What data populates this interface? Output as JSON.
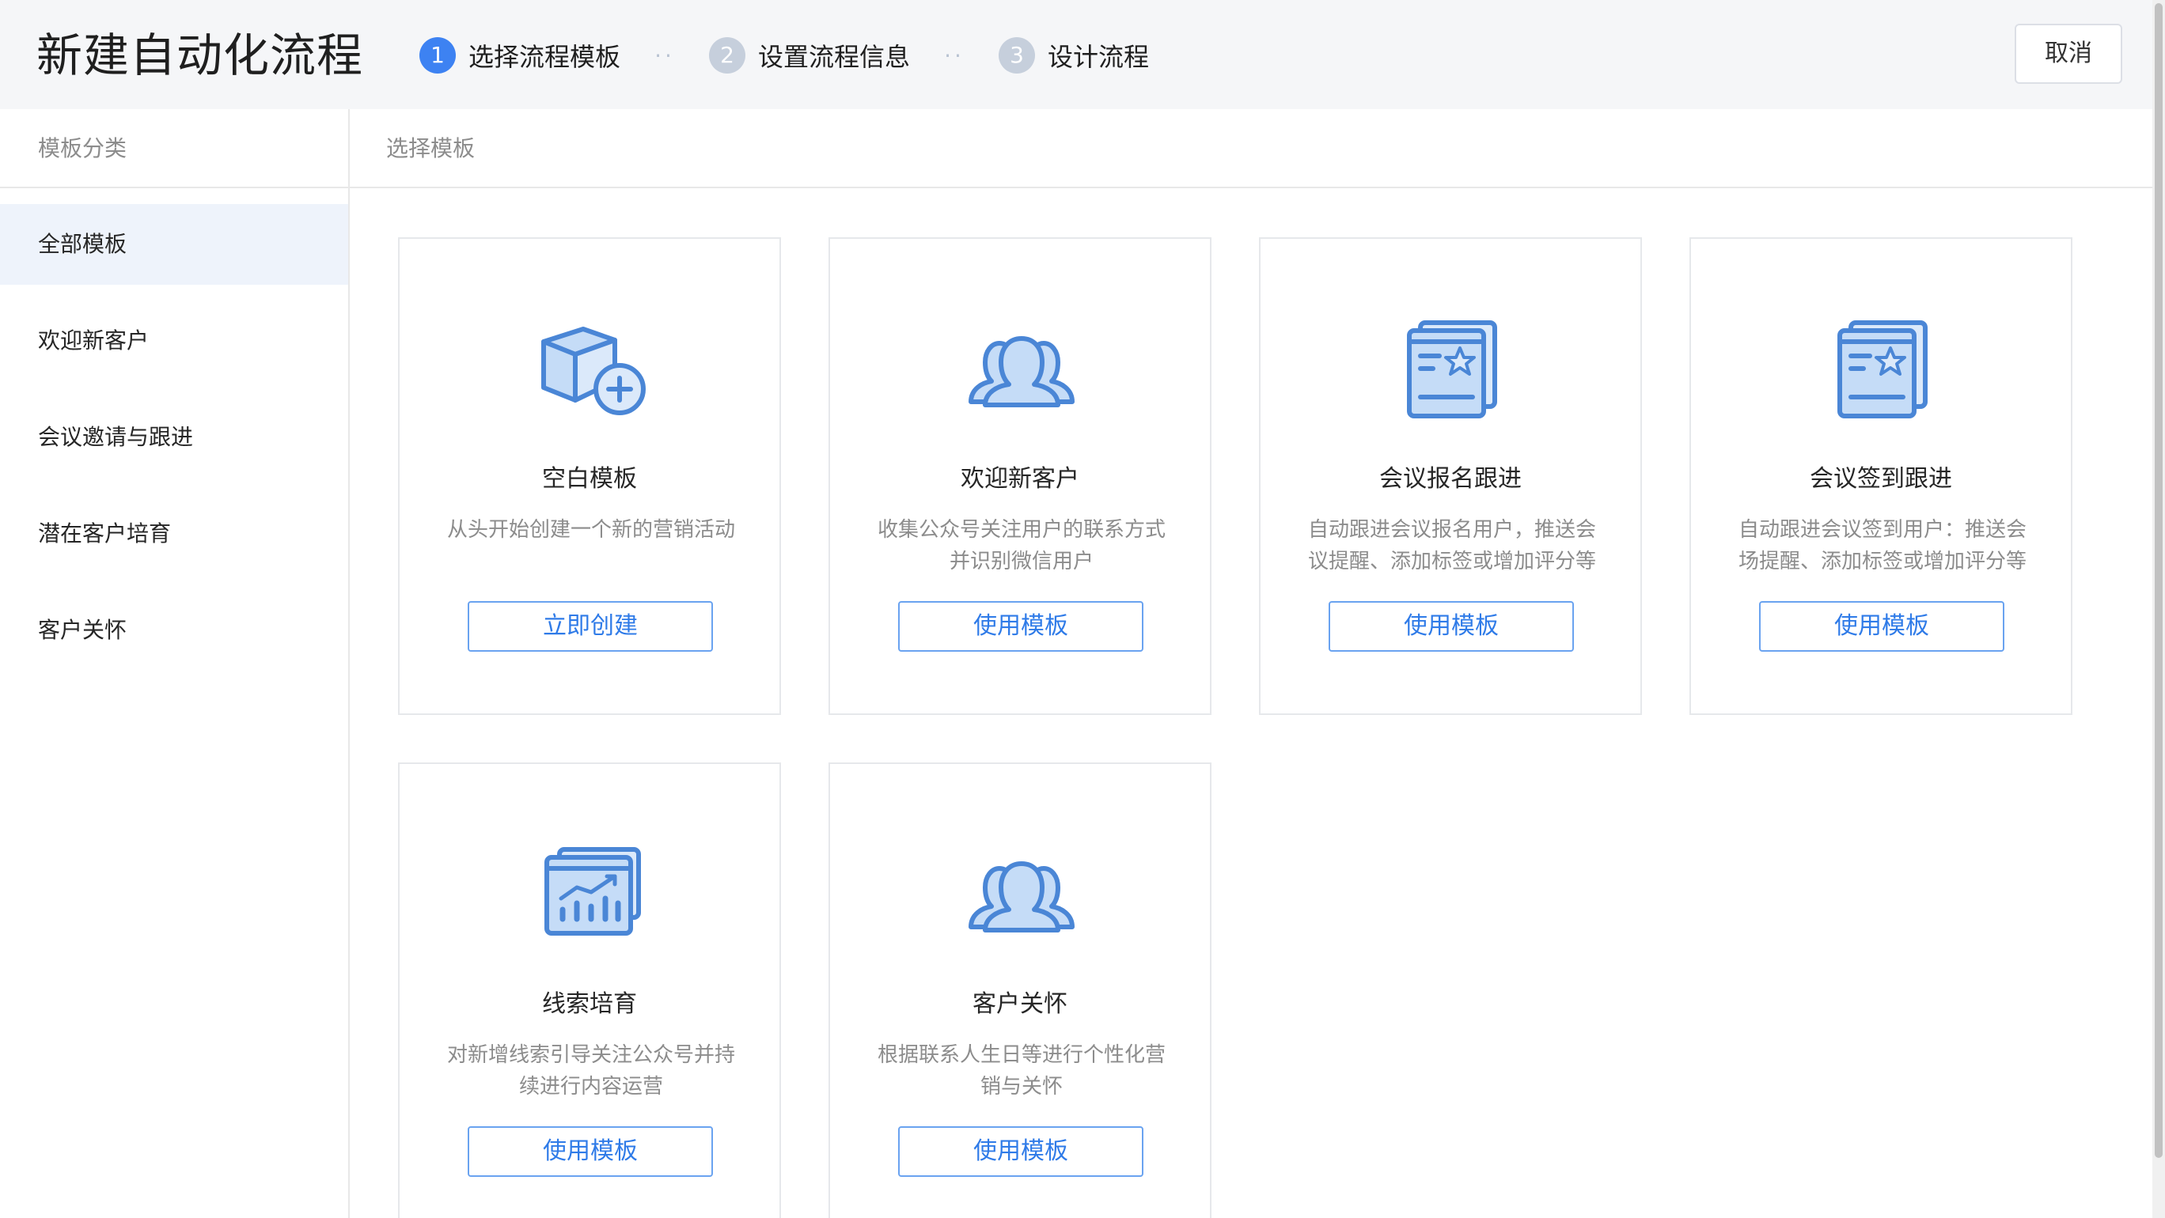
{
  "header": {
    "title": "新建自动化流程",
    "steps": [
      {
        "number": "1",
        "label": "选择流程模板",
        "state": "active"
      },
      {
        "number": "2",
        "label": "设置流程信息",
        "state": "inactive"
      },
      {
        "number": "3",
        "label": "设计流程",
        "state": "inactive"
      }
    ],
    "step_separator": "··",
    "cancel_label": "取消"
  },
  "sidebar": {
    "heading": "模板分类",
    "items": [
      {
        "label": "全部模板",
        "selected": true
      },
      {
        "label": "欢迎新客户",
        "selected": false
      },
      {
        "label": "会议邀请与跟进",
        "selected": false
      },
      {
        "label": "潜在客户培育",
        "selected": false
      },
      {
        "label": "客户关怀",
        "selected": false
      }
    ]
  },
  "main": {
    "heading": "选择模板",
    "cards": [
      {
        "icon": "box-plus-icon",
        "title": "空白模板",
        "description": "从头开始创建一个新的营销活动",
        "button": "立即创建"
      },
      {
        "icon": "users-icon",
        "title": "欢迎新客户",
        "description": "收集公众号关注用户的联系方式并识别微信用户",
        "button": "使用模板"
      },
      {
        "icon": "document-star-icon",
        "title": "会议报名跟进",
        "description": "自动跟进会议报名用户，推送会议提醒、添加标签或增加评分等",
        "button": "使用模板"
      },
      {
        "icon": "document-star-icon",
        "title": "会议签到跟进",
        "description": "自动跟进会议签到用户：推送会场提醒、添加标签或增加评分等",
        "button": "使用模板"
      },
      {
        "icon": "chart-growth-icon",
        "title": "线索培育",
        "description": "对新增线索引导关注公众号并持续进行内容运营",
        "button": "使用模板"
      },
      {
        "icon": "users-icon",
        "title": "客户关怀",
        "description": "根据联系人生日等进行个性化营销与关怀",
        "button": "使用模板"
      }
    ]
  },
  "colors": {
    "accent": "#3d82f2",
    "icon_blue": "#4a86d6",
    "icon_fill": "#c5dcf7",
    "button_text": "#2f7be8"
  }
}
